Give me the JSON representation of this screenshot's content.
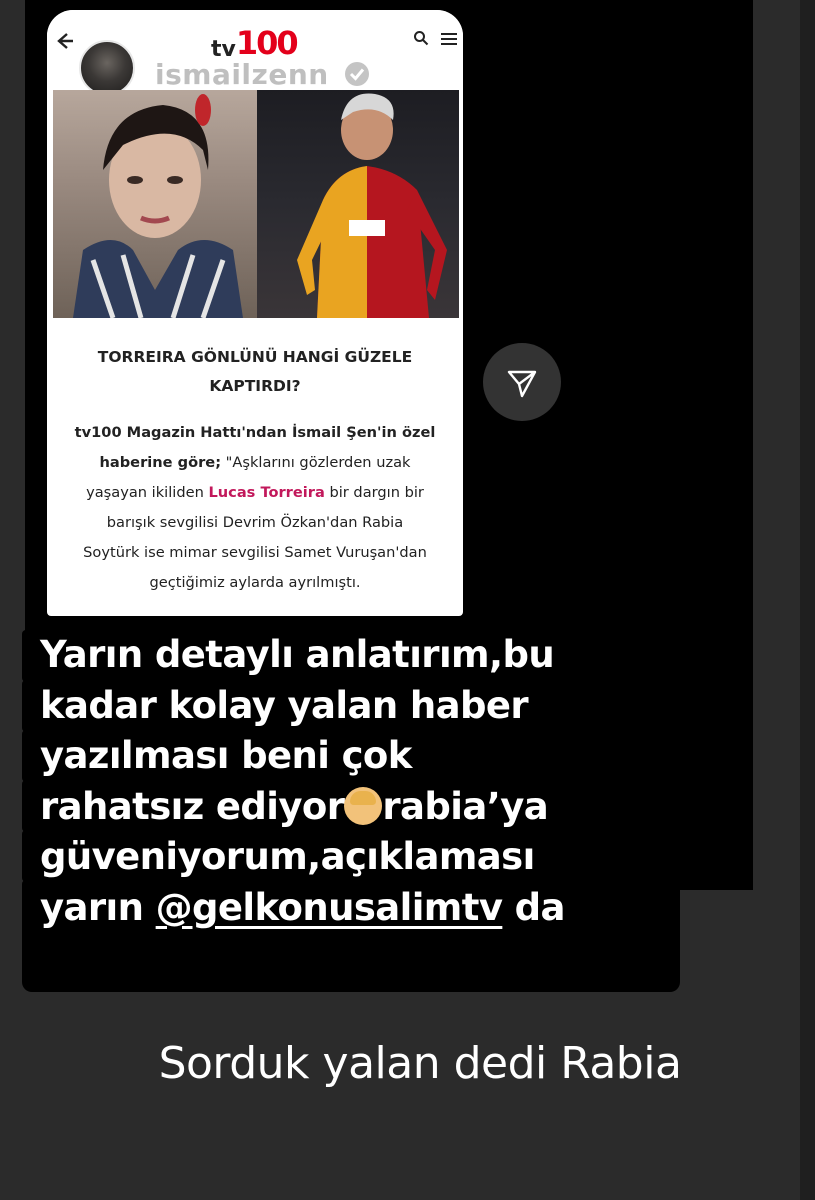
{
  "card": {
    "logo_tv": "tv",
    "logo_num": "100",
    "username": "ismailzenn",
    "headline_line1": "TORREIRA GÖNLÜNÜ HANGİ GÜZELE",
    "headline_line2": "KAPTIRDI?",
    "body": {
      "bold1": "tv100 Magazin Hattı'ndan İsmail Şen'in özel",
      "bold2": "haberine göre;",
      "p1": " \"Aşklarını gözlerden uzak",
      "p2": "yaşayan ikiliden ",
      "highlight": "Lucas Torreira",
      "p3": " bir dargın bir",
      "p4": "barışık sevgilisi Devrim Özkan'dan Rabia",
      "p5": "Soytürk ise mimar sevgilisi Samet Vuruşan'dan",
      "p6": "geçtiğimiz aylarda ayrılmıştı."
    }
  },
  "caption": {
    "line1": "Yarın detaylı anlatırım,bu",
    "line2": "kadar kolay yalan haber",
    "line3": "yazılması beni çok",
    "line4_a": "rahatsız ediyor",
    "line4_b": "rabia’ya",
    "line5": "güveniyorum,açıklaması",
    "line6_a": "yarın ",
    "mention": "@gelkonusalimtv",
    "line6_b": " da"
  },
  "subcaption": "Sorduk yalan dedi Rabia",
  "icons": [
    "back-arrow-icon",
    "verified-badge-icon",
    "search-icon",
    "menu-icon",
    "send-icon",
    "facepalm-emoji-icon"
  ],
  "colors": {
    "accent": "#e3001b",
    "highlight": "#c2185b",
    "background": "#2b2b2b"
  }
}
